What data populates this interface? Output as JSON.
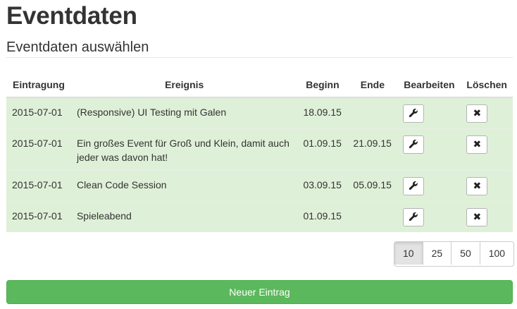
{
  "page": {
    "title": "Eventdaten",
    "subtitle": "Eventdaten auswählen"
  },
  "table": {
    "headers": {
      "entry": "Eintragung",
      "event": "Ereignis",
      "start": "Beginn",
      "end": "Ende",
      "edit": "Bearbeiten",
      "delete": "Löschen"
    },
    "rows": [
      {
        "entry": "2015-07-01",
        "event": "(Responsive) UI Testing mit Galen",
        "start": "18.09.15",
        "end": ""
      },
      {
        "entry": "2015-07-01",
        "event": "Ein großes Event für Groß und Klein, damit auch jeder was davon hat!",
        "start": "01.09.15",
        "end": "21.09.15"
      },
      {
        "entry": "2015-07-01",
        "event": "Clean Code Session",
        "start": "03.09.15",
        "end": "05.09.15"
      },
      {
        "entry": "2015-07-01",
        "event": "Spieleabend",
        "start": "01.09.15",
        "end": ""
      }
    ],
    "edit_icon": "wrench-icon",
    "delete_icon": "close-icon",
    "delete_glyph": "✖"
  },
  "pagination": {
    "options": [
      "10",
      "25",
      "50",
      "100"
    ],
    "selected": "10"
  },
  "actions": {
    "new_entry_label": "Neuer Eintrag"
  },
  "colors": {
    "row_background": "#dff0d8",
    "success_button": "#5cb85c"
  }
}
